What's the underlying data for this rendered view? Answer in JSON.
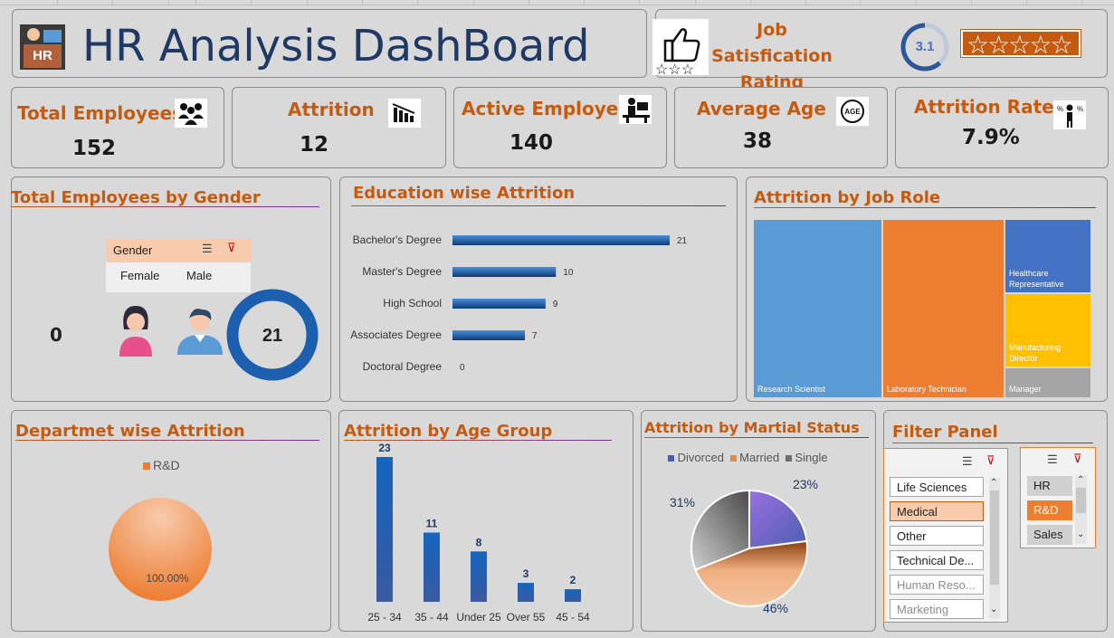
{
  "header": {
    "title": "HR Analysis DashBoard",
    "logo_text": "HR"
  },
  "satisfaction": {
    "label": "Job Satisfication Rating",
    "label_line1": "Job Satisfication",
    "label_line2": "Rating",
    "score": "3.1",
    "score_fraction": 0.62,
    "stars_total": 5
  },
  "kpis": [
    {
      "title": "Total Employees",
      "value": "152",
      "icon": "people-group-icon"
    },
    {
      "title": "Attrition",
      "value": "12",
      "icon": "decline-chart-icon"
    },
    {
      "title": "Active Employee",
      "value": "140",
      "icon": "employee-desk-icon"
    },
    {
      "title": "Average Age",
      "value": "38",
      "icon": "age-icon"
    },
    {
      "title": "Attrition Rate",
      "value": "7.9%",
      "icon": "percent-person-icon"
    }
  ],
  "gender": {
    "title": "Total Employees by Gender",
    "slicer_header": "Gender",
    "options": [
      "Female",
      "Male"
    ],
    "female_value": "0",
    "male_value": "21"
  },
  "education": {
    "title": "Education wise Attrition",
    "chart_data": {
      "type": "bar",
      "orientation": "horizontal",
      "categories": [
        "Bachelor's Degree",
        "Master's Degree",
        "High School",
        "Associates Degree",
        "Doctoral Degree"
      ],
      "values": [
        21,
        10,
        9,
        7,
        0
      ]
    }
  },
  "jobrole": {
    "title": "Attrition by Job Role",
    "chart_data": {
      "type": "treemap",
      "items": [
        {
          "label": "Research Scientist",
          "color": "#5b9bd5"
        },
        {
          "label": "Laboratory Technician",
          "color": "#ed7d31"
        },
        {
          "label": "Healthcare Representative",
          "color": "#4472c4"
        },
        {
          "label": "Manufacturing Director",
          "color": "#ffc000"
        },
        {
          "label": "Manager",
          "color": "#a5a5a5"
        }
      ]
    }
  },
  "department": {
    "title": "Departmet wise Attrition",
    "chart_data": {
      "type": "pie",
      "categories": [
        "R&D"
      ],
      "values": [
        100.0
      ],
      "labels": [
        "100.00%"
      ]
    }
  },
  "agegroup": {
    "title": "Attrition by Age Group",
    "chart_data": {
      "type": "bar",
      "categories": [
        "25 - 34",
        "35 - 44",
        "Under 25",
        "Over 55",
        "45 - 54"
      ],
      "values": [
        23,
        11,
        8,
        3,
        2
      ]
    }
  },
  "marital": {
    "title": "Attrition by Martial Status",
    "chart_data": {
      "type": "pie",
      "categories": [
        "Divorced",
        "Married",
        "Single"
      ],
      "values": [
        23,
        46,
        31
      ],
      "labels": [
        "23%",
        "46%",
        "31%"
      ],
      "colors": [
        "#7f5bc9",
        "#e08a4c",
        "#8a8a8a"
      ]
    }
  },
  "filter": {
    "title": "Filter Panel",
    "fields": [
      {
        "label": "Life Sciences",
        "state": "normal"
      },
      {
        "label": "Medical",
        "state": "selected"
      },
      {
        "label": "Other",
        "state": "normal"
      },
      {
        "label": "Technical De...",
        "state": "normal"
      },
      {
        "label": "Human Reso...",
        "state": "dim"
      },
      {
        "label": "Marketing",
        "state": "dim"
      }
    ],
    "departments": [
      {
        "label": "HR",
        "state": "normal"
      },
      {
        "label": "R&D",
        "state": "selected"
      },
      {
        "label": "Sales",
        "state": "normal"
      }
    ]
  },
  "colors": {
    "accent": "#c55a11",
    "title_blue": "#1f3864",
    "bar_blue": "#1565c0"
  }
}
